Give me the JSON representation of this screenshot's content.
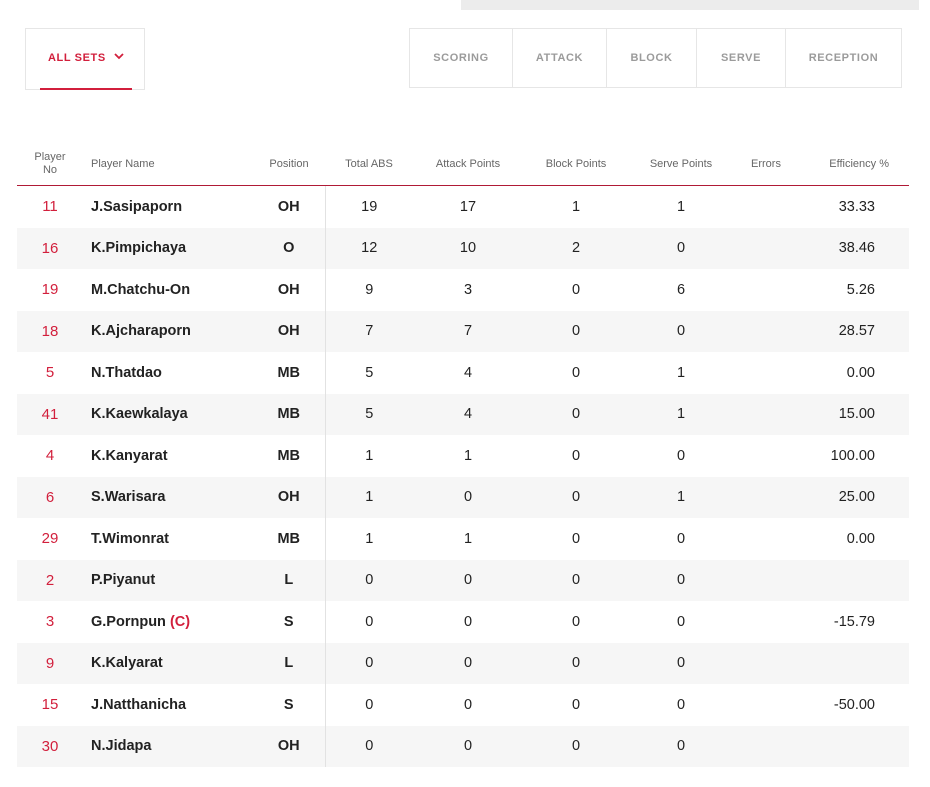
{
  "filter": {
    "label": "ALL SETS"
  },
  "tabs": [
    "SCORING",
    "ATTACK",
    "BLOCK",
    "SERVE",
    "RECEPTION"
  ],
  "columns": {
    "player_no_line1": "Player",
    "player_no_line2": "No",
    "name": "Player Name",
    "position": "Position",
    "total": "Total ABS",
    "attack": "Attack Points",
    "block": "Block Points",
    "serve": "Serve Points",
    "errors": "Errors",
    "efficiency": "Efficiency %"
  },
  "captain_mark": "(C)",
  "rows": [
    {
      "no": "11",
      "name": "J.Sasipaporn",
      "pos": "OH",
      "total": "19",
      "attack": "17",
      "block": "1",
      "serve": "1",
      "errors": "",
      "eff": "33.33"
    },
    {
      "no": "16",
      "name": "K.Pimpichaya",
      "pos": "O",
      "total": "12",
      "attack": "10",
      "block": "2",
      "serve": "0",
      "errors": "",
      "eff": "38.46"
    },
    {
      "no": "19",
      "name": "M.Chatchu-On",
      "pos": "OH",
      "total": "9",
      "attack": "3",
      "block": "0",
      "serve": "6",
      "errors": "",
      "eff": "5.26"
    },
    {
      "no": "18",
      "name": "K.Ajcharaporn",
      "pos": "OH",
      "total": "7",
      "attack": "7",
      "block": "0",
      "serve": "0",
      "errors": "",
      "eff": "28.57"
    },
    {
      "no": "5",
      "name": "N.Thatdao",
      "pos": "MB",
      "total": "5",
      "attack": "4",
      "block": "0",
      "serve": "1",
      "errors": "",
      "eff": "0.00"
    },
    {
      "no": "41",
      "name": "K.Kaewkalaya",
      "pos": "MB",
      "total": "5",
      "attack": "4",
      "block": "0",
      "serve": "1",
      "errors": "",
      "eff": "15.00"
    },
    {
      "no": "4",
      "name": "K.Kanyarat",
      "pos": "MB",
      "total": "1",
      "attack": "1",
      "block": "0",
      "serve": "0",
      "errors": "",
      "eff": "100.00"
    },
    {
      "no": "6",
      "name": "S.Warisara",
      "pos": "OH",
      "total": "1",
      "attack": "0",
      "block": "0",
      "serve": "1",
      "errors": "",
      "eff": "25.00"
    },
    {
      "no": "29",
      "name": "T.Wimonrat",
      "pos": "MB",
      "total": "1",
      "attack": "1",
      "block": "0",
      "serve": "0",
      "errors": "",
      "eff": "0.00"
    },
    {
      "no": "2",
      "name": "P.Piyanut",
      "pos": "L",
      "total": "0",
      "attack": "0",
      "block": "0",
      "serve": "0",
      "errors": "",
      "eff": ""
    },
    {
      "no": "3",
      "name": "G.Pornpun",
      "captain": true,
      "pos": "S",
      "total": "0",
      "attack": "0",
      "block": "0",
      "serve": "0",
      "errors": "",
      "eff": "-15.79"
    },
    {
      "no": "9",
      "name": "K.Kalyarat",
      "pos": "L",
      "total": "0",
      "attack": "0",
      "block": "0",
      "serve": "0",
      "errors": "",
      "eff": ""
    },
    {
      "no": "15",
      "name": "J.Natthanicha",
      "pos": "S",
      "total": "0",
      "attack": "0",
      "block": "0",
      "serve": "0",
      "errors": "",
      "eff": "-50.00"
    },
    {
      "no": "30",
      "name": "N.Jidapa",
      "pos": "OH",
      "total": "0",
      "attack": "0",
      "block": "0",
      "serve": "0",
      "errors": "",
      "eff": ""
    }
  ],
  "colors": {
    "accent": "#d21f3c",
    "muted": "#9b9b9b",
    "stripe": "#f6f6f6"
  }
}
